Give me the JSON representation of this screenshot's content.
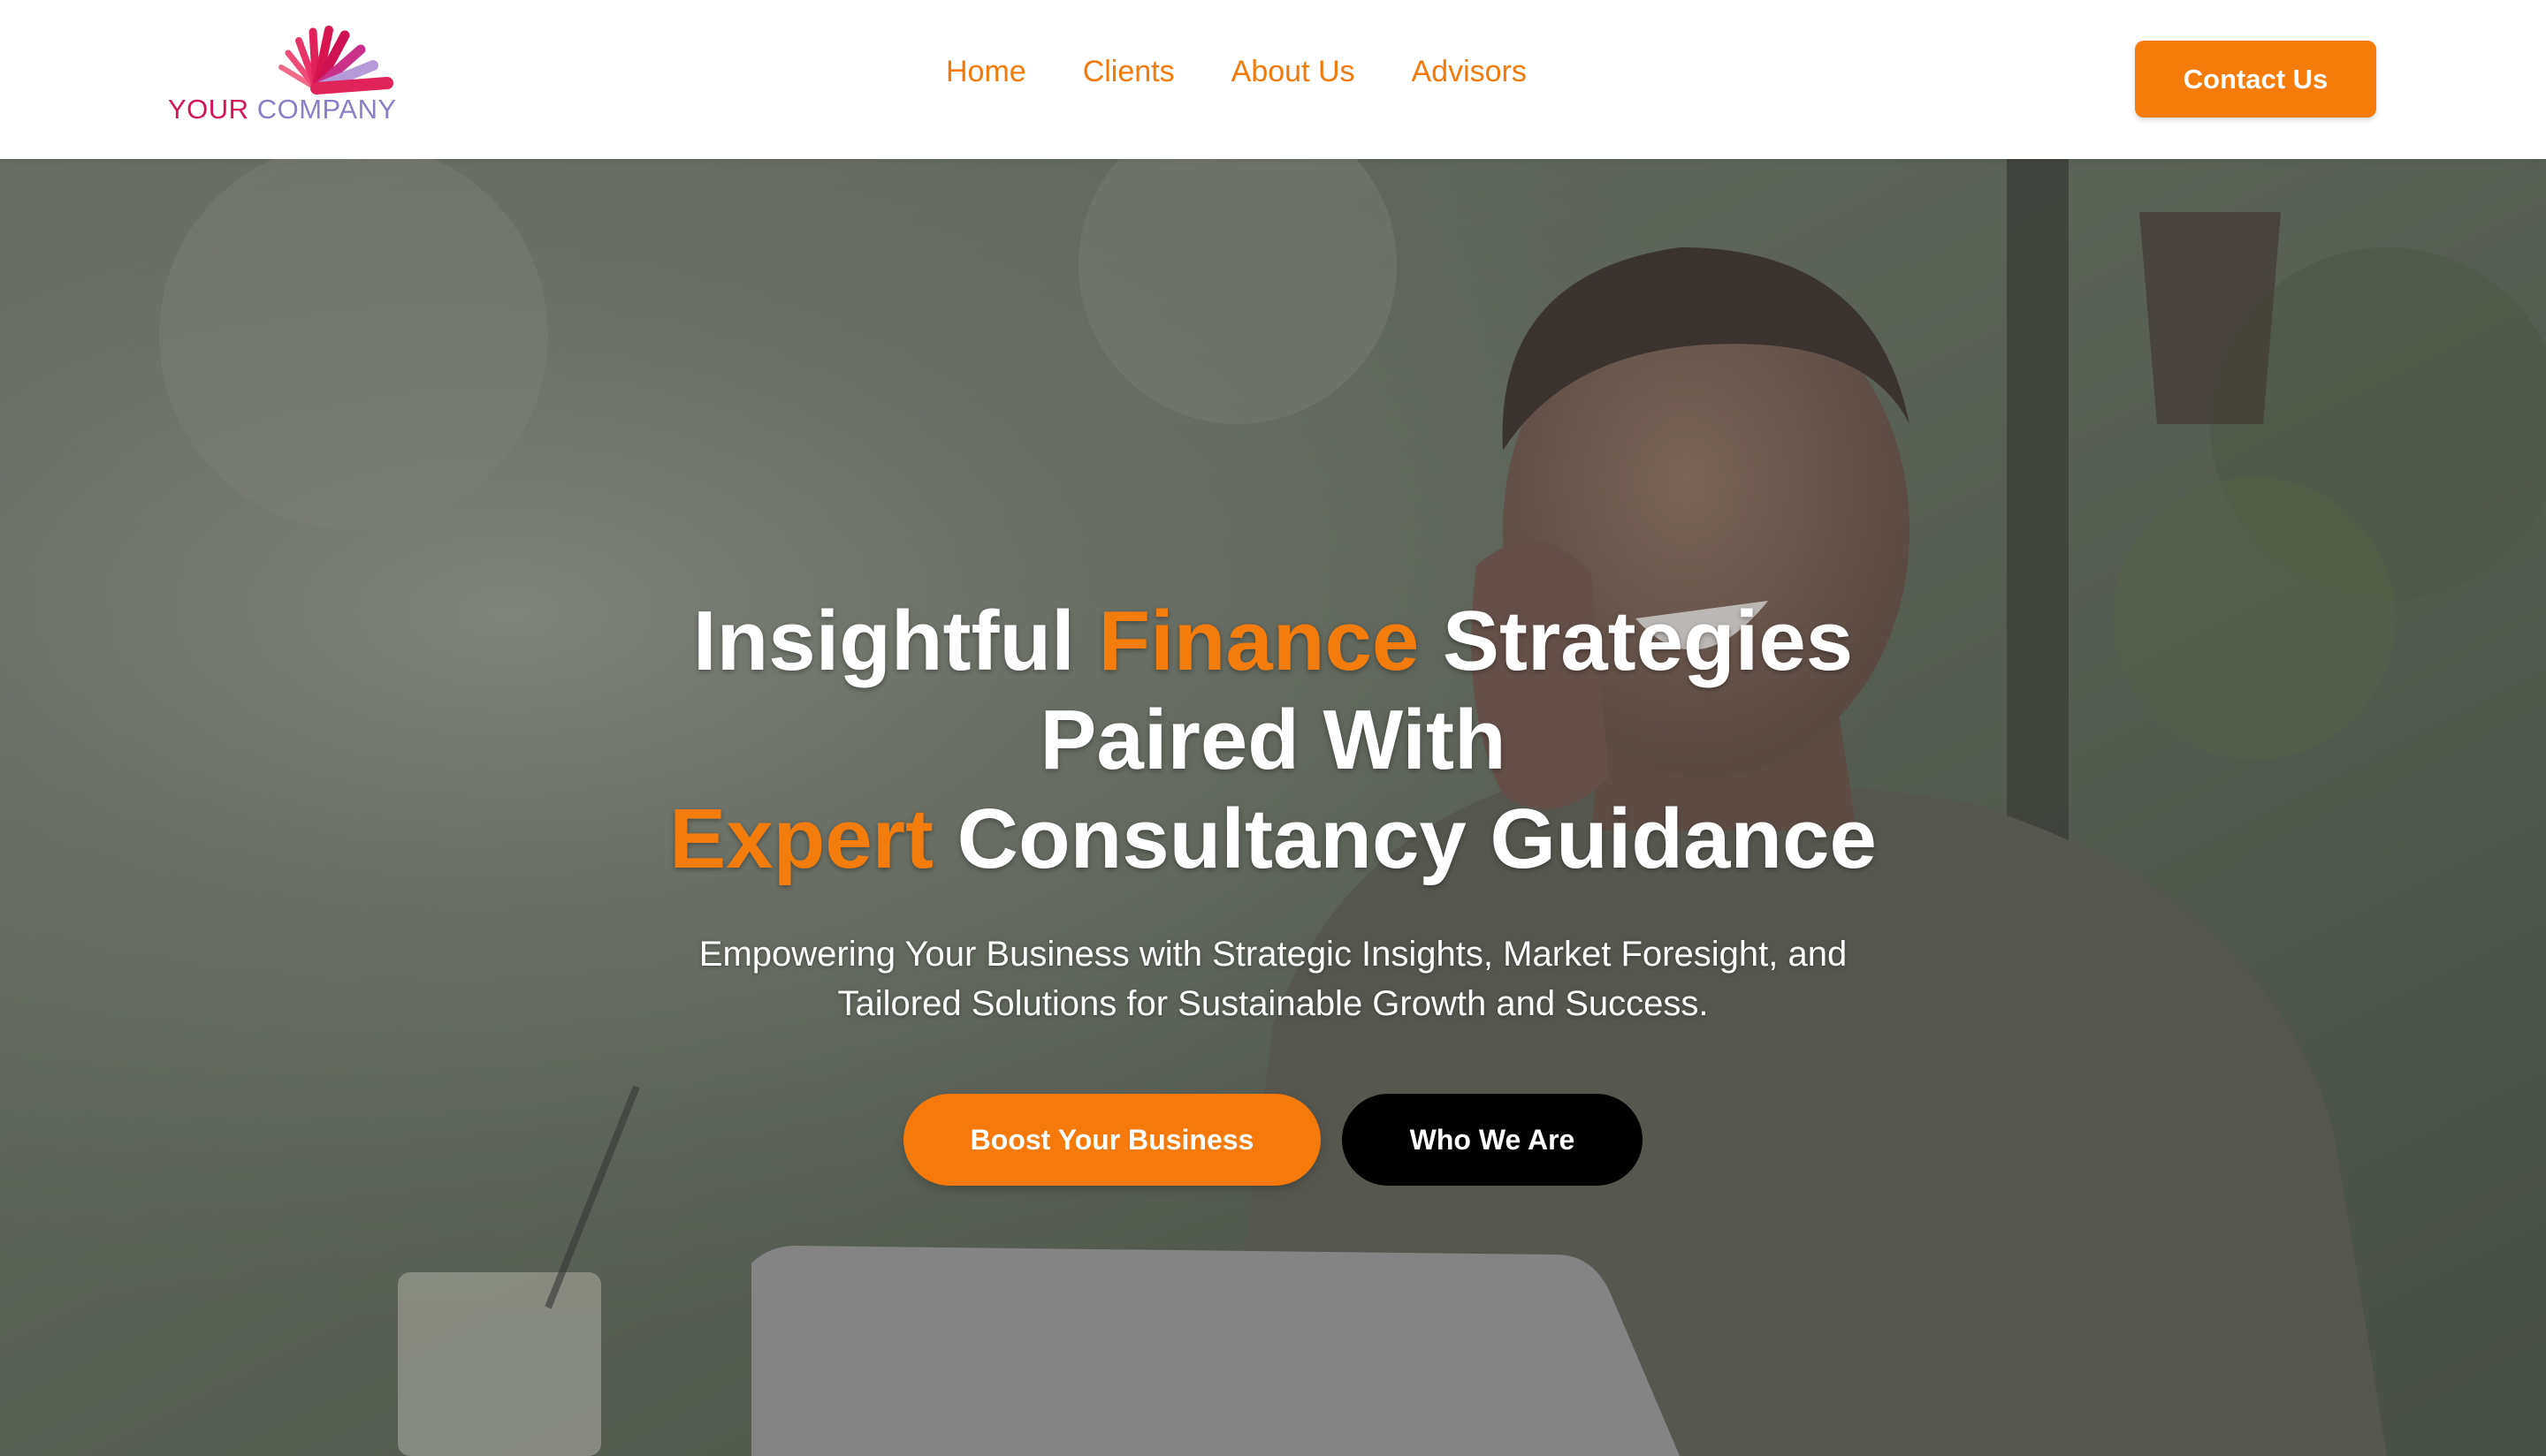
{
  "brand": {
    "logo_word1": "YOUR",
    "logo_word2": "COMPANY",
    "colors": {
      "accent": "#f57c0a",
      "logo_pink": "#d4145a",
      "logo_purple": "#8a7fc8"
    }
  },
  "nav": {
    "items": [
      {
        "label": "Home"
      },
      {
        "label": "Clients"
      },
      {
        "label": "About Us"
      },
      {
        "label": "Advisors"
      }
    ],
    "cta_label": "Contact Us"
  },
  "hero": {
    "headline": {
      "part1": "Insightful ",
      "accent1": "Finance",
      "part2": " Strategies",
      "line2": "Paired With",
      "accent2": "Expert",
      "part3": " Consultancy Guidance"
    },
    "subtext": "Empowering Your Business with Strategic Insights, Market Foresight, and Tailored Solutions for Sustainable Growth and Success.",
    "primary_cta": "Boost Your Business",
    "secondary_cta": "Who We Are",
    "background_image": "smiling-man-on-phone-photo"
  }
}
